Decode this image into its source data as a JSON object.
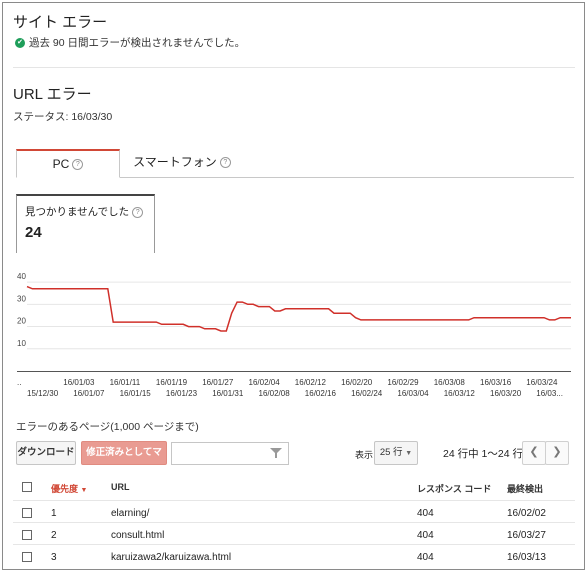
{
  "site_errors": {
    "title": "サイト エラー",
    "status_message": "過去 90 日間エラーが検出されませんでした。"
  },
  "url_errors": {
    "title": "URL エラー",
    "status_label": "ステータス: 16/03/30"
  },
  "tabs": [
    {
      "label": "PC",
      "active": true
    },
    {
      "label": "スマートフォン",
      "active": false
    }
  ],
  "metric": {
    "label": "見つかりませんでした",
    "value": "24"
  },
  "chart_data": {
    "type": "line",
    "y_ticks": [
      "40",
      "30",
      "20",
      "10"
    ],
    "ylim": [
      0,
      45
    ],
    "x_labels_top": [
      "..",
      "16/01/03",
      "16/01/11",
      "16/01/19",
      "16/01/27",
      "16/02/04",
      "16/02/12",
      "16/02/20",
      "16/02/29",
      "16/03/08",
      "16/03/16",
      "16/03/24"
    ],
    "x_labels_bottom": [
      "15/12/30",
      "16/01/07",
      "16/01/15",
      "16/01/23",
      "16/01/31",
      "16/02/08",
      "16/02/16",
      "16/02/24",
      "16/03/04",
      "16/03/12",
      "16/03/20",
      "16/03..."
    ],
    "x_start": "15/12/28",
    "series": [
      {
        "color": "#d0302a",
        "values": [
          38,
          37,
          37,
          37,
          37,
          37,
          37,
          37,
          37,
          37,
          37,
          37,
          37,
          37,
          37,
          37,
          22,
          22,
          22,
          22,
          22,
          22,
          22,
          22,
          22,
          21,
          21,
          21,
          21,
          21,
          20,
          20,
          20,
          19,
          19,
          19,
          18,
          18,
          26,
          31,
          31,
          30,
          30,
          29,
          29,
          29,
          27,
          27,
          28,
          28,
          28,
          28,
          28,
          28,
          28,
          28,
          28,
          26,
          26,
          26,
          26,
          24,
          23,
          23,
          23,
          23,
          23,
          23,
          23,
          23,
          23,
          23,
          23,
          23,
          23,
          23,
          23,
          23,
          23,
          23,
          23,
          23,
          23,
          24,
          24,
          24,
          24,
          24,
          24,
          24,
          24,
          24,
          24,
          24,
          24,
          24,
          24,
          23,
          23,
          24,
          24,
          24
        ]
      }
    ]
  },
  "table_section": {
    "heading": "エラーのあるページ(1,000 ページまで)",
    "download_label": "ダウンロード",
    "mark_fixed_label": "修正済みとしてマーク",
    "filter_placeholder": "",
    "show_label": "表示",
    "rows_select": "25 行",
    "pagination": "24 行中 1〜24 行",
    "columns": [
      "優先度",
      "URL",
      "レスポンス コード",
      "最終検出"
    ],
    "rows": [
      {
        "priority": "1",
        "url": "elarning/",
        "code": "404",
        "detected": "16/02/02"
      },
      {
        "priority": "2",
        "url": "consult.html",
        "code": "404",
        "detected": "16/03/27"
      },
      {
        "priority": "3",
        "url": "karuizawa2/karuizawa.html",
        "code": "404",
        "detected": "16/03/13"
      }
    ]
  },
  "icons": {
    "check": "check-circle-icon",
    "help": "help-icon",
    "filter": "filter-icon",
    "sort": "sort-desc-icon",
    "prev": "chevron-left-icon",
    "next": "chevron-right-icon"
  }
}
